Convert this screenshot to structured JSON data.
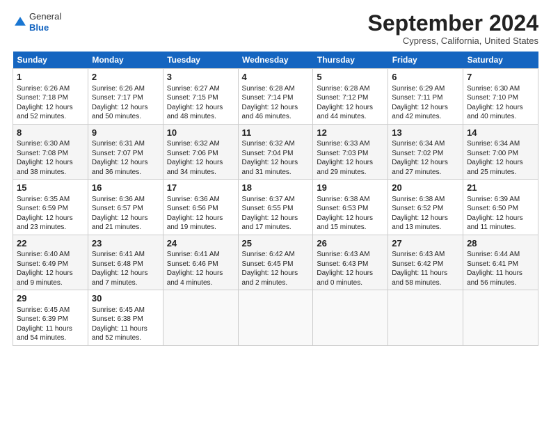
{
  "header": {
    "logo_general": "General",
    "logo_blue": "Blue",
    "title": "September 2024",
    "location": "Cypress, California, United States"
  },
  "columns": [
    "Sunday",
    "Monday",
    "Tuesday",
    "Wednesday",
    "Thursday",
    "Friday",
    "Saturday"
  ],
  "weeks": [
    [
      {
        "day": "1",
        "lines": [
          "Sunrise: 6:26 AM",
          "Sunset: 7:18 PM",
          "Daylight: 12 hours",
          "and 52 minutes."
        ]
      },
      {
        "day": "2",
        "lines": [
          "Sunrise: 6:26 AM",
          "Sunset: 7:17 PM",
          "Daylight: 12 hours",
          "and 50 minutes."
        ]
      },
      {
        "day": "3",
        "lines": [
          "Sunrise: 6:27 AM",
          "Sunset: 7:15 PM",
          "Daylight: 12 hours",
          "and 48 minutes."
        ]
      },
      {
        "day": "4",
        "lines": [
          "Sunrise: 6:28 AM",
          "Sunset: 7:14 PM",
          "Daylight: 12 hours",
          "and 46 minutes."
        ]
      },
      {
        "day": "5",
        "lines": [
          "Sunrise: 6:28 AM",
          "Sunset: 7:12 PM",
          "Daylight: 12 hours",
          "and 44 minutes."
        ]
      },
      {
        "day": "6",
        "lines": [
          "Sunrise: 6:29 AM",
          "Sunset: 7:11 PM",
          "Daylight: 12 hours",
          "and 42 minutes."
        ]
      },
      {
        "day": "7",
        "lines": [
          "Sunrise: 6:30 AM",
          "Sunset: 7:10 PM",
          "Daylight: 12 hours",
          "and 40 minutes."
        ]
      }
    ],
    [
      {
        "day": "8",
        "lines": [
          "Sunrise: 6:30 AM",
          "Sunset: 7:08 PM",
          "Daylight: 12 hours",
          "and 38 minutes."
        ]
      },
      {
        "day": "9",
        "lines": [
          "Sunrise: 6:31 AM",
          "Sunset: 7:07 PM",
          "Daylight: 12 hours",
          "and 36 minutes."
        ]
      },
      {
        "day": "10",
        "lines": [
          "Sunrise: 6:32 AM",
          "Sunset: 7:06 PM",
          "Daylight: 12 hours",
          "and 34 minutes."
        ]
      },
      {
        "day": "11",
        "lines": [
          "Sunrise: 6:32 AM",
          "Sunset: 7:04 PM",
          "Daylight: 12 hours",
          "and 31 minutes."
        ]
      },
      {
        "day": "12",
        "lines": [
          "Sunrise: 6:33 AM",
          "Sunset: 7:03 PM",
          "Daylight: 12 hours",
          "and 29 minutes."
        ]
      },
      {
        "day": "13",
        "lines": [
          "Sunrise: 6:34 AM",
          "Sunset: 7:02 PM",
          "Daylight: 12 hours",
          "and 27 minutes."
        ]
      },
      {
        "day": "14",
        "lines": [
          "Sunrise: 6:34 AM",
          "Sunset: 7:00 PM",
          "Daylight: 12 hours",
          "and 25 minutes."
        ]
      }
    ],
    [
      {
        "day": "15",
        "lines": [
          "Sunrise: 6:35 AM",
          "Sunset: 6:59 PM",
          "Daylight: 12 hours",
          "and 23 minutes."
        ]
      },
      {
        "day": "16",
        "lines": [
          "Sunrise: 6:36 AM",
          "Sunset: 6:57 PM",
          "Daylight: 12 hours",
          "and 21 minutes."
        ]
      },
      {
        "day": "17",
        "lines": [
          "Sunrise: 6:36 AM",
          "Sunset: 6:56 PM",
          "Daylight: 12 hours",
          "and 19 minutes."
        ]
      },
      {
        "day": "18",
        "lines": [
          "Sunrise: 6:37 AM",
          "Sunset: 6:55 PM",
          "Daylight: 12 hours",
          "and 17 minutes."
        ]
      },
      {
        "day": "19",
        "lines": [
          "Sunrise: 6:38 AM",
          "Sunset: 6:53 PM",
          "Daylight: 12 hours",
          "and 15 minutes."
        ]
      },
      {
        "day": "20",
        "lines": [
          "Sunrise: 6:38 AM",
          "Sunset: 6:52 PM",
          "Daylight: 12 hours",
          "and 13 minutes."
        ]
      },
      {
        "day": "21",
        "lines": [
          "Sunrise: 6:39 AM",
          "Sunset: 6:50 PM",
          "Daylight: 12 hours",
          "and 11 minutes."
        ]
      }
    ],
    [
      {
        "day": "22",
        "lines": [
          "Sunrise: 6:40 AM",
          "Sunset: 6:49 PM",
          "Daylight: 12 hours",
          "and 9 minutes."
        ]
      },
      {
        "day": "23",
        "lines": [
          "Sunrise: 6:41 AM",
          "Sunset: 6:48 PM",
          "Daylight: 12 hours",
          "and 7 minutes."
        ]
      },
      {
        "day": "24",
        "lines": [
          "Sunrise: 6:41 AM",
          "Sunset: 6:46 PM",
          "Daylight: 12 hours",
          "and 4 minutes."
        ]
      },
      {
        "day": "25",
        "lines": [
          "Sunrise: 6:42 AM",
          "Sunset: 6:45 PM",
          "Daylight: 12 hours",
          "and 2 minutes."
        ]
      },
      {
        "day": "26",
        "lines": [
          "Sunrise: 6:43 AM",
          "Sunset: 6:43 PM",
          "Daylight: 12 hours",
          "and 0 minutes."
        ]
      },
      {
        "day": "27",
        "lines": [
          "Sunrise: 6:43 AM",
          "Sunset: 6:42 PM",
          "Daylight: 11 hours",
          "and 58 minutes."
        ]
      },
      {
        "day": "28",
        "lines": [
          "Sunrise: 6:44 AM",
          "Sunset: 6:41 PM",
          "Daylight: 11 hours",
          "and 56 minutes."
        ]
      }
    ],
    [
      {
        "day": "29",
        "lines": [
          "Sunrise: 6:45 AM",
          "Sunset: 6:39 PM",
          "Daylight: 11 hours",
          "and 54 minutes."
        ]
      },
      {
        "day": "30",
        "lines": [
          "Sunrise: 6:45 AM",
          "Sunset: 6:38 PM",
          "Daylight: 11 hours",
          "and 52 minutes."
        ]
      },
      null,
      null,
      null,
      null,
      null
    ]
  ]
}
